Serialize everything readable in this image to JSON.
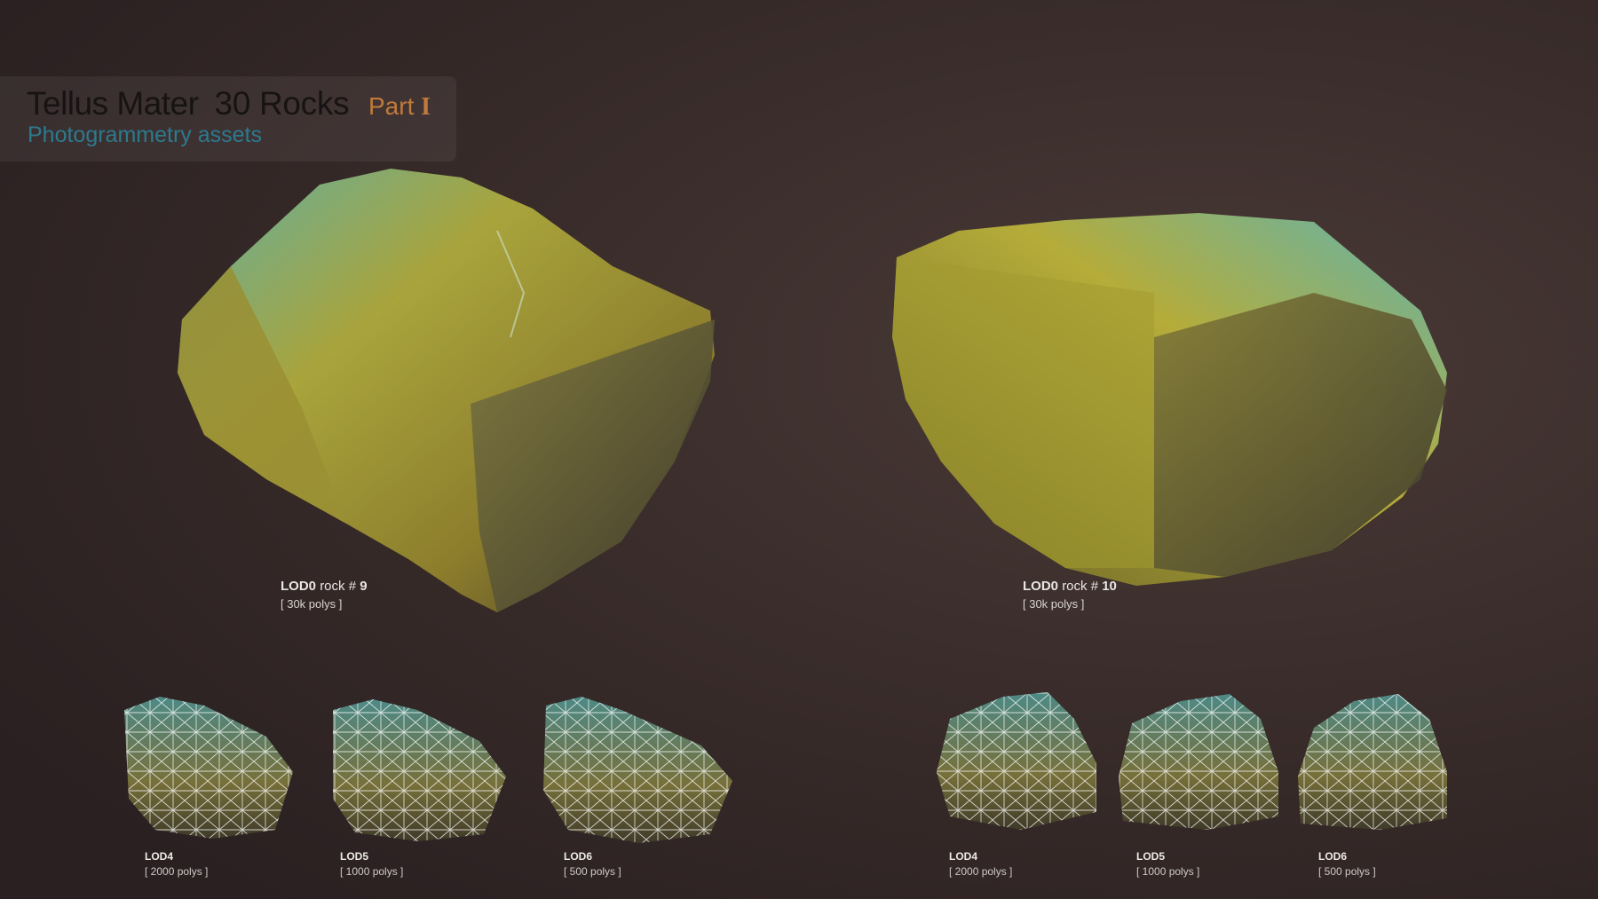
{
  "header": {
    "brand": "Tellus Mater",
    "count": "30 Rocks",
    "part_label": "Part",
    "part_numeral": "I",
    "subtitle": "Photogrammetry assets"
  },
  "rocks": [
    {
      "lod_label": "LOD0",
      "rock_text": "rock #",
      "rock_number": "9",
      "polys": "[ 30k polys ]",
      "lods": [
        {
          "label": "LOD4",
          "polys": "[ 2000 polys ]"
        },
        {
          "label": "LOD5",
          "polys": "[ 1000 polys ]"
        },
        {
          "label": "LOD6",
          "polys": "[ 500 polys ]"
        }
      ]
    },
    {
      "lod_label": "LOD0",
      "rock_text": "rock #",
      "rock_number": "10",
      "polys": "[ 30k polys ]",
      "lods": [
        {
          "label": "LOD4",
          "polys": "[ 2000 polys ]"
        },
        {
          "label": "LOD5",
          "polys": "[ 1000 polys ]"
        },
        {
          "label": "LOD6",
          "polys": "[ 500 polys ]"
        }
      ]
    }
  ],
  "colors": {
    "background": "#3a2d2b",
    "rock_yellow": "#b8a830",
    "rock_teal": "#4fa7a0",
    "part_orange": "#c27a3a",
    "subtitle_teal": "#2c7a8e"
  }
}
